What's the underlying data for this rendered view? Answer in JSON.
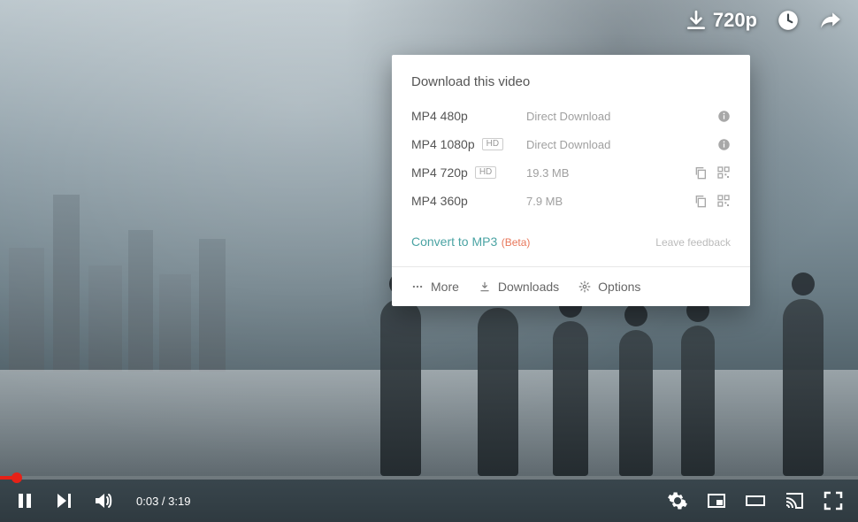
{
  "topBar": {
    "quality": "720p"
  },
  "popup": {
    "title": "Download this video",
    "rows": [
      {
        "format": "MP4 480p",
        "hd": false,
        "info": "Direct Download",
        "icons": "info"
      },
      {
        "format": "MP4 1080p",
        "hd": true,
        "info": "Direct Download",
        "icons": "info"
      },
      {
        "format": "MP4 720p",
        "hd": true,
        "info": "19.3 MB",
        "icons": "copyqr"
      },
      {
        "format": "MP4 360p",
        "hd": false,
        "info": "7.9 MB",
        "icons": "copyqr"
      }
    ],
    "convert": "Convert to MP3",
    "beta": "(Beta)",
    "feedback": "Leave feedback",
    "footer": {
      "more": "More",
      "downloads": "Downloads",
      "options": "Options"
    },
    "hdBadge": "HD"
  },
  "controls": {
    "time": "0:03 / 3:19"
  }
}
